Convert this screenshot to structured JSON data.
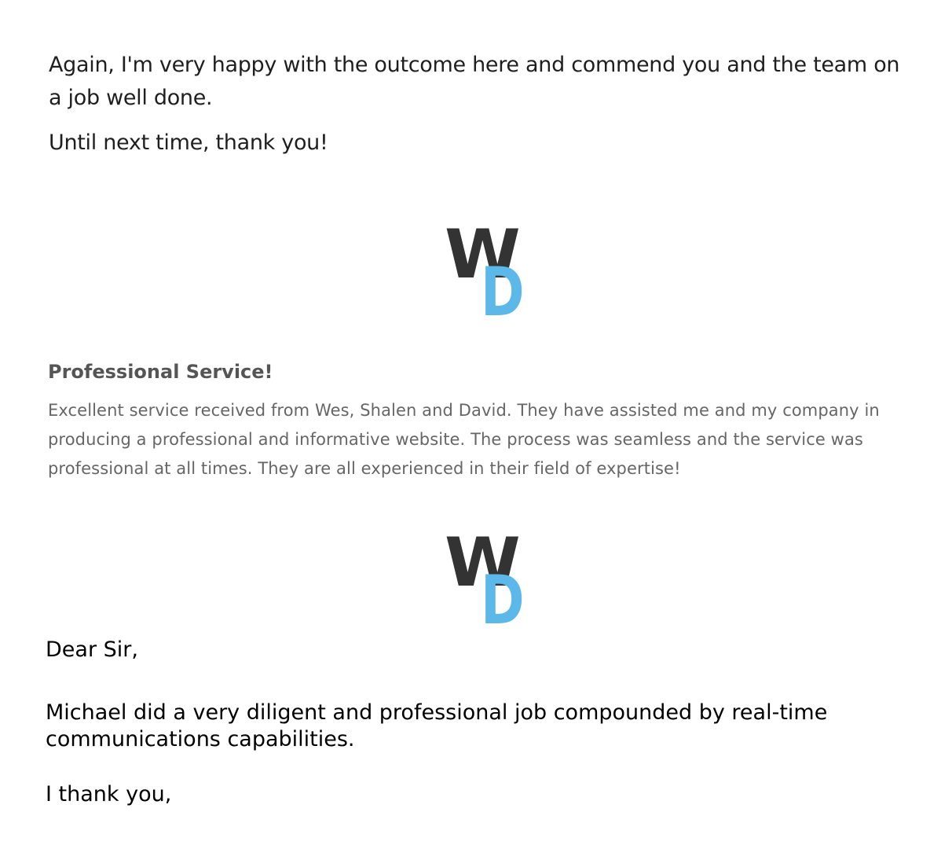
{
  "top_message": {
    "line1": "Again, I'm very happy with the outcome here and commend you and the team on a job well done.",
    "line2": "Until next time, thank you!"
  },
  "logo": {
    "letter_w": "W",
    "letter_d": "D",
    "color_w": "#333333",
    "color_d": "#5bb8e8"
  },
  "review": {
    "title": "Professional Service!",
    "body": "Excellent service received from Wes, Shalen and David. They have assisted me and my company in producing a professional and informative website. The process was seamless and the service was professional at all times. They are all experienced in their field of expertise!"
  },
  "letter": {
    "greeting": "Dear Sir,",
    "body": "Michael did a very diligent and professional job compounded by real-time communications capabilities.",
    "signoff": "I thank you,"
  }
}
